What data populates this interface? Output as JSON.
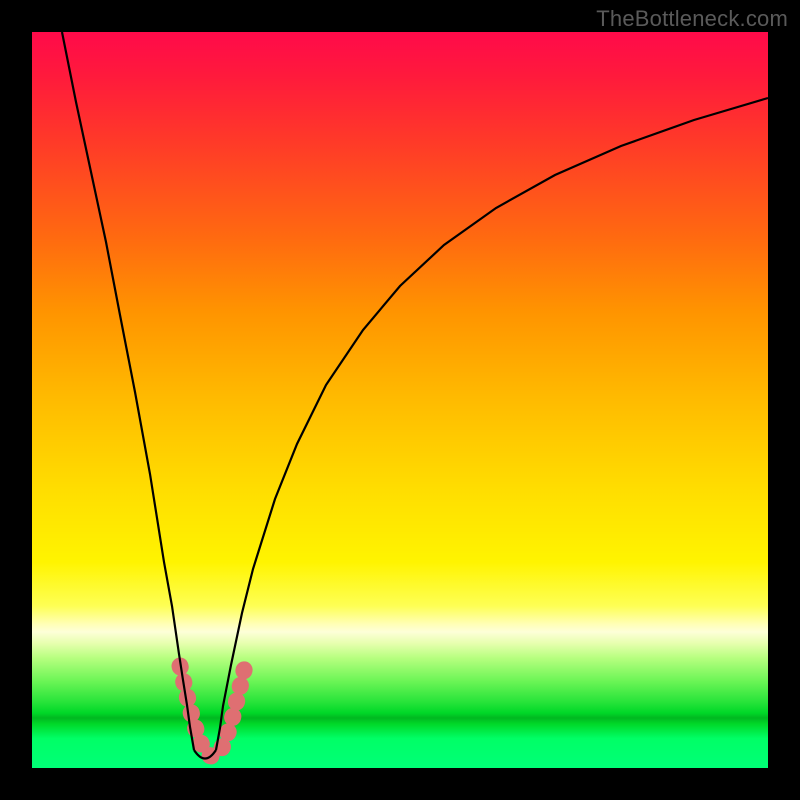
{
  "watermark": "TheBottleneck.com",
  "chart_data": {
    "type": "line",
    "title": "",
    "xlabel": "",
    "ylabel": "",
    "x_range": [
      0,
      100
    ],
    "y_range": [
      0,
      100
    ],
    "background_gradient_stops": [
      {
        "pos": 0,
        "color": "#ff0a4a"
      },
      {
        "pos": 15,
        "color": "#ff3a28"
      },
      {
        "pos": 38,
        "color": "#ff9400"
      },
      {
        "pos": 62,
        "color": "#ffdd00"
      },
      {
        "pos": 81,
        "color": "#ffffd0"
      },
      {
        "pos": 88,
        "color": "#70f658"
      },
      {
        "pos": 93,
        "color": "#00c022"
      },
      {
        "pos": 100,
        "color": "#00ff77"
      }
    ],
    "series": [
      {
        "name": "left-branch",
        "stroke": "#000000",
        "x": [
          4,
          6,
          8,
          10,
          12,
          14,
          16,
          18,
          19,
          20,
          20.5,
          21,
          21.5,
          22
        ],
        "y": [
          100,
          90.5,
          81,
          71.5,
          61.5,
          51,
          40,
          28,
          22,
          15.5,
          12,
          8.5,
          5.5,
          2.5
        ]
      },
      {
        "name": "right-branch",
        "stroke": "#000000",
        "x": [
          25,
          25.5,
          26,
          27,
          28.5,
          30,
          33,
          36,
          40,
          45,
          50,
          56,
          63,
          71,
          80,
          90,
          100
        ],
        "y": [
          2.5,
          5.5,
          8.5,
          14,
          21,
          27,
          36.5,
          44,
          52,
          59.5,
          65.5,
          71,
          76,
          80.5,
          84.5,
          88,
          91
        ]
      },
      {
        "name": "valley-highlight",
        "stroke": "#e07070",
        "stroke_width": 14,
        "x": [
          20.2,
          20.8,
          21.4,
          22.0,
          22.7,
          23.5,
          24.3,
          25.0,
          25.6,
          26.2,
          26.8
        ],
        "y": [
          14.0,
          10.5,
          7.0,
          4.0,
          2.0,
          1.2,
          2.0,
          4.0,
          7.0,
          10.5,
          14.0
        ]
      }
    ],
    "annotations": []
  }
}
